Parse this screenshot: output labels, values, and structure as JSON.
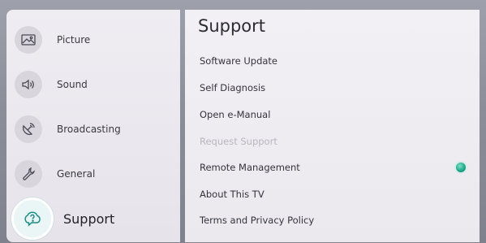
{
  "sidebar": {
    "items": [
      {
        "label": "Picture",
        "icon": "picture-icon"
      },
      {
        "label": "Sound",
        "icon": "speaker-icon"
      },
      {
        "label": "Broadcasting",
        "icon": "satellite-dish-icon"
      },
      {
        "label": "General",
        "icon": "wrench-icon"
      },
      {
        "label": "Support",
        "icon": "support-cloud-icon",
        "selected": true
      }
    ]
  },
  "panel": {
    "title": "Support",
    "items": [
      {
        "label": "Software Update",
        "enabled": true
      },
      {
        "label": "Self Diagnosis",
        "enabled": true
      },
      {
        "label": "Open e-Manual",
        "enabled": true
      },
      {
        "label": "Request Support",
        "enabled": false
      },
      {
        "label": "Remote Management",
        "enabled": true,
        "status": "on"
      },
      {
        "label": "About This TV",
        "enabled": true
      },
      {
        "label": "Terms and Privacy Policy",
        "enabled": true
      }
    ]
  },
  "colors": {
    "accent": "#1fa98a",
    "background": "#8b8e98",
    "panel": "#efedf2",
    "disabled_text": "#b9b7be"
  }
}
